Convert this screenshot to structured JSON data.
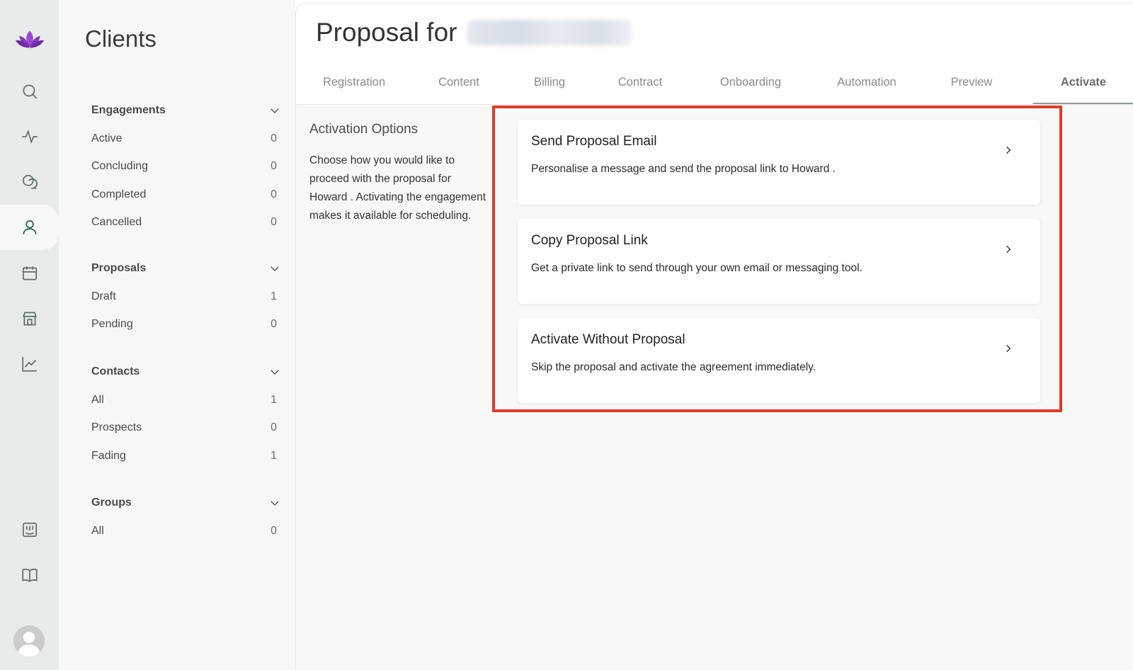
{
  "sidebar": {
    "title": "Clients",
    "sections": [
      {
        "label": "Engagements",
        "items": [
          {
            "label": "Active",
            "count": "0"
          },
          {
            "label": "Concluding",
            "count": "0"
          },
          {
            "label": "Completed",
            "count": "0"
          },
          {
            "label": "Cancelled",
            "count": "0"
          }
        ]
      },
      {
        "label": "Proposals",
        "items": [
          {
            "label": "Draft",
            "count": "1"
          },
          {
            "label": "Pending",
            "count": "0"
          }
        ]
      },
      {
        "label": "Contacts",
        "items": [
          {
            "label": "All",
            "count": "1"
          },
          {
            "label": "Prospects",
            "count": "0"
          },
          {
            "label": "Fading",
            "count": "1"
          }
        ]
      },
      {
        "label": "Groups",
        "items": [
          {
            "label": "All",
            "count": "0"
          }
        ]
      }
    ]
  },
  "rail": {
    "icons": [
      "lotus-logo-icon",
      "search-icon",
      "activity-icon",
      "chat-icon",
      "clients-icon",
      "calendar-icon",
      "store-icon",
      "chart-icon",
      "feedback-icon",
      "book-icon",
      "avatar"
    ],
    "active": "clients-icon",
    "brand_color": "#8e3fc4"
  },
  "header": {
    "title_prefix": "Proposal for"
  },
  "tabs": [
    {
      "label": "Registration"
    },
    {
      "label": "Content"
    },
    {
      "label": "Billing"
    },
    {
      "label": "Contract"
    },
    {
      "label": "Onboarding"
    },
    {
      "label": "Automation"
    },
    {
      "label": "Preview"
    },
    {
      "label": "Activate",
      "active": true
    }
  ],
  "activation": {
    "title": "Activation Options",
    "description": "Choose how you would like to proceed with the proposal for Howard . Activating the engagement makes it available for scheduling.",
    "options": [
      {
        "title": "Send Proposal Email",
        "description": "Personalise a message and send the proposal link to Howard ."
      },
      {
        "title": "Copy Proposal Link",
        "description": "Get a private link to send through your own email or messaging tool."
      },
      {
        "title": "Activate Without Proposal",
        "description": "Skip the proposal and activate the agreement immediately."
      }
    ]
  },
  "colors": {
    "highlight_frame": "#e23a23",
    "rail_bg": "#e7ebe9",
    "sidebar_bg": "#f6f8f7"
  }
}
